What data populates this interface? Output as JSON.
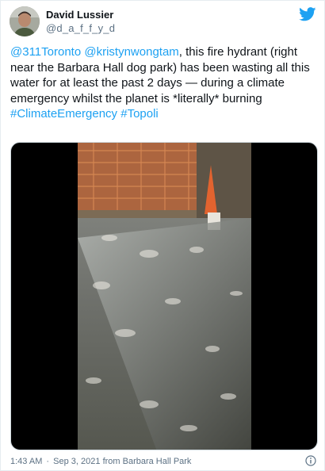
{
  "author": {
    "display_name": "David Lussier",
    "handle": "@d_a_f_f_y_d",
    "avatar_icon": "avatar-photo"
  },
  "brand": {
    "icon": "twitter-bird-icon",
    "color": "#1da1f2"
  },
  "tweet": {
    "mention_1": "@311Toronto",
    "mention_2": "@kristynwongtam",
    "text_body": ", this fire hydrant (right near the Barbara Hall dog park) has been wasting all this water for at least the past 2 days — during a climate emergency whilst the planet is *literally* burning",
    "hashtag_1": "#ClimateEmergency",
    "hashtag_2": "#Topoli"
  },
  "media": {
    "type": "video-still",
    "description_icon": "video-frame"
  },
  "footer": {
    "time": "1:43 AM",
    "separator": "·",
    "date": "Sep 3, 2021",
    "source": "from Barbara Hall Park",
    "info_icon": "info-icon"
  },
  "colors": {
    "link": "#1da1f2",
    "secondary_text": "#5b7083",
    "primary_text": "#0f1419"
  }
}
